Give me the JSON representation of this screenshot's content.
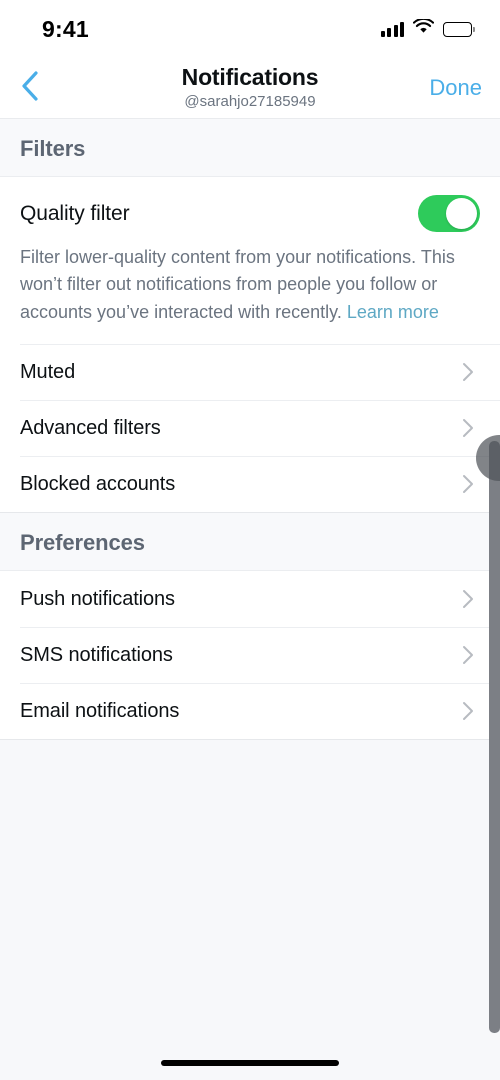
{
  "status_bar": {
    "time": "9:41",
    "signal_icon": "signal-bars-icon",
    "wifi_icon": "wifi-icon",
    "battery_icon": "battery-full-icon"
  },
  "nav": {
    "back_icon": "chevron-left-icon",
    "title": "Notifications",
    "subtitle": "@sarahjo27185949",
    "done_label": "Done",
    "done_color": "#4aaee8"
  },
  "sections": [
    {
      "header": "Filters",
      "toggle_row": {
        "label": "Quality filter",
        "toggle_on": true,
        "toggle_on_color": "#2ecb5b"
      },
      "description": {
        "text": "Filter lower-quality content from your notifications. This won’t filter out notifications from people you follow or accounts you’ve interacted with recently. ",
        "link_label": "Learn more",
        "link_color": "#5ea8c4"
      },
      "rows": [
        {
          "label": "Muted",
          "accessory_icon": "chevron-right-icon"
        },
        {
          "label": "Advanced filters",
          "accessory_icon": "chevron-right-icon"
        },
        {
          "label": "Blocked accounts",
          "accessory_icon": "chevron-right-icon"
        }
      ]
    },
    {
      "header": "Preferences",
      "rows": [
        {
          "label": "Push notifications",
          "accessory_icon": "chevron-right-icon"
        },
        {
          "label": "SMS notifications",
          "accessory_icon": "chevron-right-icon"
        },
        {
          "label": "Email notifications",
          "accessory_icon": "chevron-right-icon"
        }
      ]
    }
  ],
  "scrollbar": {
    "name": "vertical-scrollbar",
    "color": "#7c7f85"
  },
  "cursor": {
    "name": "pointer-cursor",
    "color": "#50545a"
  },
  "home_indicator": {
    "color": "#000000"
  }
}
